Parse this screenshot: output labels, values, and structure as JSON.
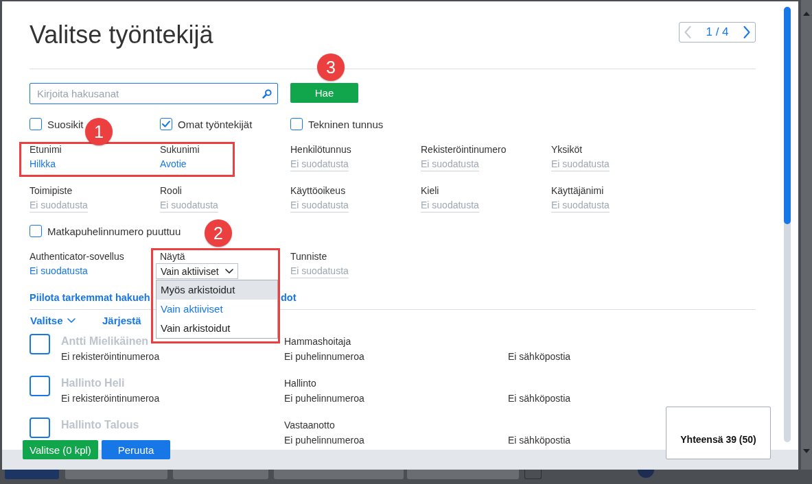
{
  "dialog": {
    "title": "Valitse työntekijä",
    "pager": {
      "label": "1 / 4",
      "prev_disabled": true,
      "next_disabled": false
    }
  },
  "search": {
    "placeholder": "Kirjoita hakusanat",
    "button": "Hae",
    "callout": {
      "number": "3",
      "boxed": false
    }
  },
  "quick_filters": [
    {
      "label": "Suosikit",
      "checked": false
    },
    {
      "label": "Omat työntekijät",
      "checked": true
    },
    {
      "label": "Tekninen tunnus",
      "checked": false
    }
  ],
  "filter_sections": [
    {
      "kind": "fields",
      "callout": {
        "number": "1",
        "boxed": true
      },
      "fields": [
        {
          "kind": "link",
          "label": "Etunimi",
          "value": "Hilkka",
          "active": true
        },
        {
          "kind": "link",
          "label": "Sukunimi",
          "value": "Avotie",
          "active": true
        },
        {
          "kind": "link",
          "label": "Henkilötunnus",
          "value": "Ei suodatusta",
          "active": false
        },
        {
          "kind": "link",
          "label": "Rekisteröintinumero",
          "value": "Ei suodatusta",
          "active": false
        },
        {
          "kind": "link",
          "label": "Yksiköt",
          "value": "Ei suodatusta",
          "active": false
        }
      ]
    },
    {
      "kind": "fields",
      "fields": [
        {
          "kind": "link",
          "label": "Toimipiste",
          "value": "Ei suodatusta",
          "active": false
        },
        {
          "kind": "link",
          "label": "Rooli",
          "value": "Ei suodatusta",
          "active": false
        },
        {
          "kind": "link",
          "label": "Käyttöoikeus",
          "value": "Ei suodatusta",
          "active": false
        },
        {
          "kind": "link",
          "label": "Kieli",
          "value": "Ei suodatusta",
          "active": false
        },
        {
          "kind": "link",
          "label": "Käyttäjänimi",
          "value": "Ei suodatusta",
          "active": false
        }
      ]
    },
    {
      "kind": "checkbox",
      "label": "Matkapuhelinnumero puuttuu",
      "checked": false
    },
    {
      "kind": "fields",
      "fields": [
        {
          "kind": "link",
          "label": "Authenticator-sovellus",
          "value": "Ei suodatusta",
          "active": true
        },
        {
          "kind": "select",
          "label": "Näytä",
          "value": "Vain aktiiviset",
          "expanded": true,
          "callout": {
            "number": "2",
            "boxed": true
          },
          "options": [
            {
              "label": "Myös arkistoidut",
              "hovered": true,
              "selected": false
            },
            {
              "label": "Vain aktiiviset",
              "hovered": false,
              "selected": true
            },
            {
              "label": "Vain arkistoidut",
              "hovered": false,
              "selected": false
            }
          ]
        },
        {
          "kind": "link",
          "label": "Tunniste",
          "value": "Ei suodatusta",
          "active": false
        }
      ]
    }
  ],
  "toggle_link": {
    "visible_start": "Piilota tarkemmat hakueh",
    "visible_end": "dot"
  },
  "list_toolbar": [
    {
      "kind": "menu",
      "label": "Valitse"
    },
    {
      "kind": "action",
      "label": "Järjestä"
    }
  ],
  "employees": [
    {
      "name": "Antti Mielikäinen",
      "reg": "Ei rekisteröintinumeroa",
      "role": "Hammashoitaja",
      "phone": "Ei puhelinnumeroa",
      "email": "Ei sähköpostia",
      "checked": false
    },
    {
      "name": "Hallinto Heli",
      "reg": "Ei rekisteröintinumeroa",
      "role": "Hallinto",
      "phone": "Ei puhelinnumeroa",
      "email": "Ei sähköpostia",
      "checked": false
    },
    {
      "name": "Hallinto Talous",
      "role": "Vastaanotto",
      "phone": "Ei puhelinnumeroa",
      "email": "Ei sähköpostia",
      "checked": false
    }
  ],
  "footer": {
    "select_button": "Valitse (0 kpl)",
    "cancel_button": "Peruuta",
    "total": "Yhteensä 39 (50)"
  }
}
